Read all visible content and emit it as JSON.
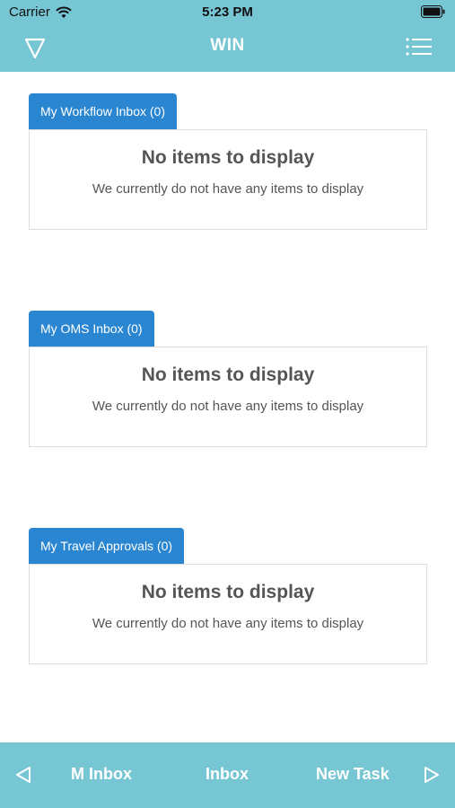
{
  "status_bar": {
    "carrier": "Carrier",
    "time": "5:23 PM"
  },
  "header": {
    "title": "WIN",
    "left_icon": "filter-icon",
    "right_icon": "list-menu-icon"
  },
  "sections": [
    {
      "tab_label": "My Workflow Inbox (0)",
      "empty_title": "No items to display",
      "empty_message": "We currently do not have any items to display"
    },
    {
      "tab_label": "My OMS Inbox (0)",
      "empty_title": "No items to display",
      "empty_message": "We currently do not have any items to display"
    },
    {
      "tab_label": "My Travel Approvals (0)",
      "empty_title": "No items to display",
      "empty_message": "We currently do not have any items to display"
    }
  ],
  "footer": {
    "items": [
      "M Inbox",
      "Inbox",
      "New Task"
    ],
    "left_icon": "triangle-left-icon",
    "right_icon": "triangle-right-icon"
  },
  "colors": {
    "header_bg": "#76c6d4",
    "tab_bg": "#2a86d0",
    "text_muted": "#555555",
    "border": "#dddddd"
  }
}
